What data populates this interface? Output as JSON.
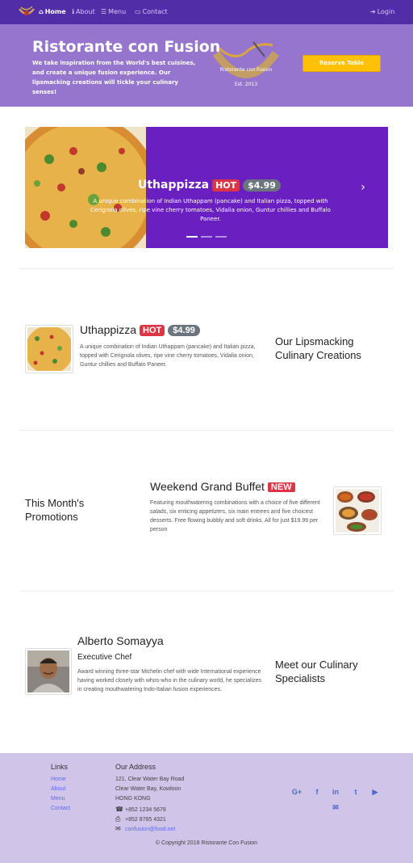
{
  "navbar": {
    "brand_logo_icon": "restaurant-logo",
    "items": [
      {
        "label": "Home",
        "icon": "home-icon",
        "active": true
      },
      {
        "label": "About",
        "icon": "info-icon",
        "active": false
      },
      {
        "label": "Menu",
        "icon": "list-icon",
        "active": false
      },
      {
        "label": "Contact",
        "icon": "address-card-icon",
        "active": false
      }
    ],
    "login_label": "Login",
    "login_icon": "sign-in-icon",
    "colors": {
      "background": "#512da8"
    }
  },
  "jumbotron": {
    "title": "Ristorante con Fusion",
    "text": "We take inspiration from the World's best cuisines, and create a unique fusion experience. Our lipsmacking creations will tickle your culinary senses!",
    "logo_text": "Ristorante con Fusion",
    "logo_est": "Est. 2013",
    "reserve_label": "Reserve Table",
    "colors": {
      "background": "#9575cd",
      "button": "#ffc107"
    }
  },
  "carousel": {
    "title": "Uthappizza",
    "badge": "HOT",
    "price": "$4.99",
    "text": "A unique combination of Indian Uthappam (pancake) and Italian pizza, topped with Cerignola olives, ripe vine cherry tomatoes, Vidalia onion, Guntur chillies and Buffalo Paneer.",
    "next_icon": "chevron-right-icon",
    "slide_count": 3,
    "active_slide": 1
  },
  "dish": {
    "title": "Uthappizza",
    "badge": "HOT",
    "price": "$4.99",
    "text": "A unique combination of Indian Uthappam (pancake) and Italian pizza, topped with Cerignola olives, ripe vine cherry tomatoes, Vidalia onion, Guntur chillies and Buffalo Paneer.",
    "side_heading": "Our Lipsmacking Culinary Creations"
  },
  "promotion": {
    "side_heading": "This Month's Promotions",
    "title": "Weekend Grand Buffet",
    "badge": "NEW",
    "text": "Featuring mouthwatering combinations with a choice of five different salads, six enticing appetizers, six main entrees and five choicest desserts. Free flowing bubbly and soft drinks. All for just $19.99 per person"
  },
  "leader": {
    "name": "Alberto Somayya",
    "designation": "Executive Chef",
    "text": "Award winning three-star Michelin chef with wide International experience having worked closely with whos-who in the culinary world, he specializes in creating mouthwatering Indo-Italian fusion experiences.",
    "side_heading": "Meet our Culinary Specialists"
  },
  "footer": {
    "links_heading": "Links",
    "links": [
      "Home",
      "About",
      "Menu",
      "Contact"
    ],
    "address_heading": "Our Address",
    "address_lines": [
      "121, Clear Water Bay Road",
      "Clear Water Bay, Kowloon",
      "HONG KONG"
    ],
    "phone": "+852 1234 5678",
    "fax": "+852 8765 4321",
    "email": "confusion@food.net",
    "social": [
      {
        "name": "google-plus-icon",
        "glyph": "G+"
      },
      {
        "name": "facebook-icon",
        "glyph": "f"
      },
      {
        "name": "linkedin-icon",
        "glyph": "in"
      },
      {
        "name": "twitter-icon",
        "glyph": "t"
      },
      {
        "name": "youtube-icon",
        "glyph": "▶"
      },
      {
        "name": "mail-icon",
        "glyph": "✉"
      }
    ],
    "copyright": "© Copyright 2018 Ristorante Con Fusion",
    "colors": {
      "background": "#d1c4e9",
      "link": "#5b6cf0"
    }
  }
}
